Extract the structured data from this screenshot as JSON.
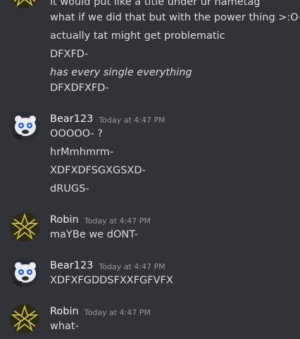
{
  "messages": {
    "m0": {
      "lines": [
        "it would put like a title under ur nametag",
        "what if we did that but with the power thing >:O-",
        "actually tat might get problematic",
        "DFXFD-",
        "has every single everything",
        "DFXDFXFD-"
      ]
    },
    "m1": {
      "author": "Bear123",
      "timestamp": "Today at 4:47 PM",
      "lines": [
        "OOOOO- ?",
        "hrMmhmrm-",
        "XDFXDFSGXGSXD-",
        "dRUGS-"
      ]
    },
    "m2": {
      "author": "Robin",
      "timestamp": "Today at 4:47 PM",
      "lines": [
        "maYBe we dONT-"
      ]
    },
    "m3": {
      "author": "Bear123",
      "timestamp": "Today at 4:47 PM",
      "lines": [
        "XDFXFGDDSFXXFGFVFX"
      ]
    },
    "m4": {
      "author": "Robin",
      "timestamp": "Today at 4:47 PM",
      "lines": [
        "what-"
      ]
    }
  },
  "colors": {
    "background": "#313338",
    "text": "#dbdee1",
    "timestamp": "#949ba4",
    "robin_avatar_bg": "#2b2a17",
    "robin_avatar_star": "#c9b84a",
    "bear_avatar_bg": "#2a2d33"
  },
  "icons": {
    "robin_avatar": "yellow-star-sigil-avatar",
    "bear_avatar": "bear-face-avatar"
  }
}
